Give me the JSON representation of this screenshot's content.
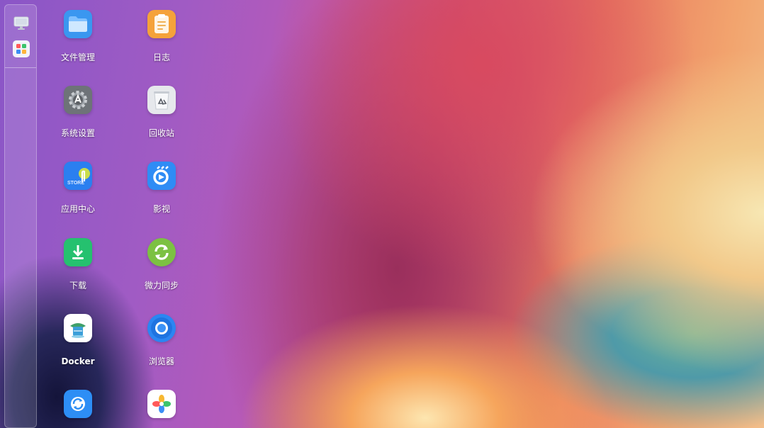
{
  "dock": {
    "items": [
      {
        "icon": "monitor-icon"
      },
      {
        "icon": "app-grid-icon"
      }
    ]
  },
  "desktop": {
    "apps": [
      {
        "label": "文件管理",
        "icon": "folder-icon",
        "color": "#3a97f0"
      },
      {
        "label": "日志",
        "icon": "log-icon",
        "color": "#f5a23a"
      },
      {
        "label": "系统设置",
        "icon": "gear-icon",
        "color": "#6e7378"
      },
      {
        "label": "回收站",
        "icon": "recycle-bin-icon",
        "color": "#e6e8ec"
      },
      {
        "label": "应用中心",
        "icon": "app-store-icon",
        "color": "#2b7ff0"
      },
      {
        "label": "影视",
        "icon": "video-icon",
        "color": "#2f8cf5"
      },
      {
        "label": "下载",
        "icon": "download-icon",
        "color": "#25c16f"
      },
      {
        "label": "微力同步",
        "icon": "sync-icon",
        "color": "#7cc142"
      },
      {
        "label": "Docker",
        "icon": "docker-icon",
        "color": "#ffffff"
      },
      {
        "label": "浏览器",
        "icon": "browser-icon",
        "color": "#2b86f2"
      },
      {
        "label": "",
        "icon": "backup-icon",
        "color": "#2d8ef5"
      },
      {
        "label": "",
        "icon": "photos-icon",
        "color": "#ffffff"
      }
    ]
  }
}
